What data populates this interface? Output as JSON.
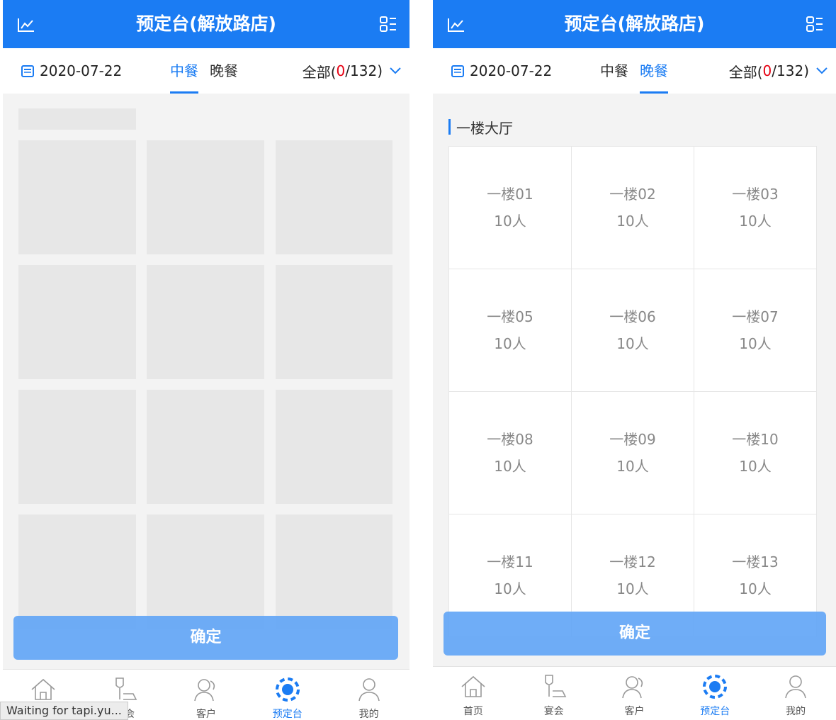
{
  "header": {
    "title": "预定台(解放路店)"
  },
  "toolbar": {
    "date": "2020-07-22",
    "tabs": [
      "中餐",
      "晚餐"
    ],
    "filter_prefix": "全部(",
    "filter_count": "0",
    "filter_suffix": "/132)"
  },
  "left_screen": {
    "active_tab": "中餐",
    "status_text": "Waiting for tapi.yu..."
  },
  "right_screen": {
    "active_tab": "晚餐",
    "section_title": "一楼大厅",
    "tables": [
      {
        "name": "一楼01",
        "capacity": "10人"
      },
      {
        "name": "一楼02",
        "capacity": "10人"
      },
      {
        "name": "一楼03",
        "capacity": "10人"
      },
      {
        "name": "一楼05",
        "capacity": "10人"
      },
      {
        "name": "一楼06",
        "capacity": "10人"
      },
      {
        "name": "一楼07",
        "capacity": "10人"
      },
      {
        "name": "一楼08",
        "capacity": "10人"
      },
      {
        "name": "一楼09",
        "capacity": "10人"
      },
      {
        "name": "一楼10",
        "capacity": "10人"
      },
      {
        "name": "一楼11",
        "capacity": "10人"
      },
      {
        "name": "一楼12",
        "capacity": "10人"
      },
      {
        "name": "一楼13",
        "capacity": "10人"
      }
    ]
  },
  "confirm_label": "确定",
  "bottom_nav": [
    {
      "label": "首页",
      "icon": "home-icon"
    },
    {
      "label": "宴会",
      "icon": "wine-glass-icon"
    },
    {
      "label": "客户",
      "icon": "customers-icon"
    },
    {
      "label": "预定台",
      "icon": "reservation-icon",
      "active": true
    },
    {
      "label": "我的",
      "icon": "user-icon"
    }
  ],
  "colors": {
    "primary": "#1b7cf3",
    "highlight": "#e60012",
    "confirm": "#63a6f6"
  }
}
